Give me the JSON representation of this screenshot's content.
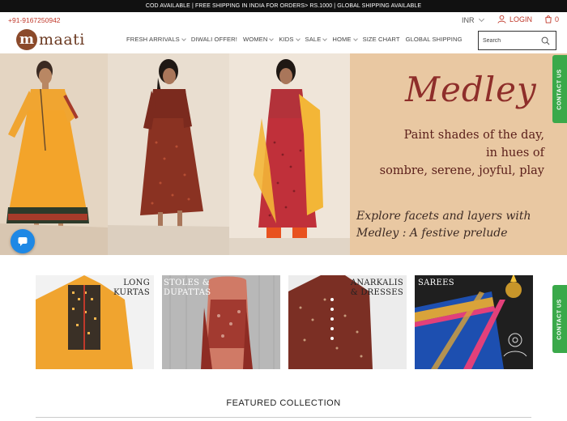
{
  "announcement": "COD AVAILABLE | FREE SHIPPING IN INDIA FOR ORDERS> RS.1000 | GLOBAL SHIPPING AVAILABLE",
  "header": {
    "phone": "+91-9167250942",
    "currency": "INR",
    "login": "LOGIN",
    "cart_count": "0",
    "logo_mark": "m",
    "logo_text": "maati"
  },
  "nav": [
    {
      "label": "FRESH ARRIVALS",
      "has_dropdown": true
    },
    {
      "label": "DIWALI OFFER!",
      "has_dropdown": false
    },
    {
      "label": "WOMEN",
      "has_dropdown": true
    },
    {
      "label": "KIDS",
      "has_dropdown": true
    },
    {
      "label": "SALE",
      "has_dropdown": true
    },
    {
      "label": "HOME",
      "has_dropdown": true
    },
    {
      "label": "SIZE CHART",
      "has_dropdown": false
    },
    {
      "label": "GLOBAL SHIPPING",
      "has_dropdown": false
    }
  ],
  "search": {
    "placeholder": "Search"
  },
  "hero": {
    "title": "Medley",
    "tagline_1": "Paint shades of the day,",
    "tagline_2": "in hues of",
    "tagline_3": "sombre, serene, joyful, play",
    "explore_1": "Explore facets and layers with",
    "explore_2": "Medley : A festive prelude"
  },
  "contact_tab": "CONTACT US",
  "categories": [
    {
      "line1": "LONG",
      "line2": "KURTAS"
    },
    {
      "line1": "STOLES &",
      "line2": "DUPATTAS"
    },
    {
      "line1": "ANARKALIS",
      "line2": "& DRESSES"
    },
    {
      "line1": "SAREES",
      "line2": ""
    }
  ],
  "featured_heading": "FEATURED COLLECTION",
  "colors": {
    "accent": "#c0392b",
    "brand": "#6b3a22",
    "contact": "#3aa94a",
    "chat": "#1e88e5",
    "medley": "#8e2e2a"
  },
  "icons": [
    "chevron-down-icon",
    "user-icon",
    "cart-icon",
    "search-icon",
    "chat-icon",
    "mail-icon"
  ]
}
